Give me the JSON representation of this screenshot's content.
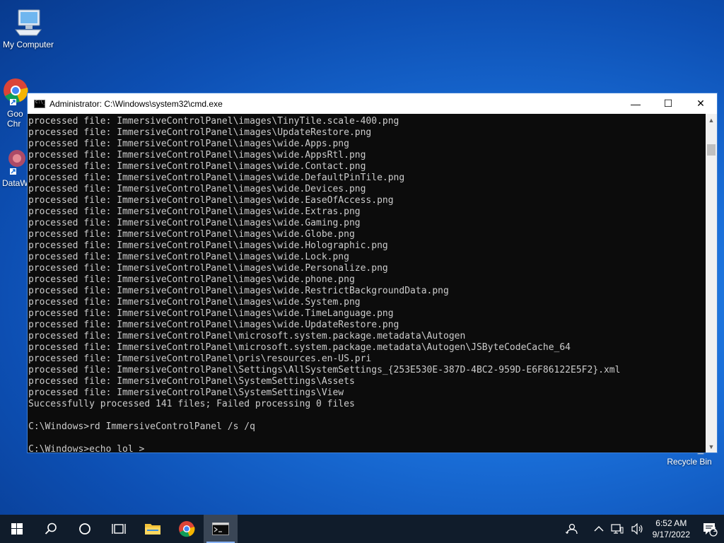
{
  "desktop": {
    "icons": [
      {
        "label": "My Computer"
      },
      {
        "label": "Goo Chr"
      },
      {
        "label": "DataW"
      },
      {
        "label": "Recycle Bin"
      }
    ]
  },
  "window": {
    "title": "Administrator: C:\\Windows\\system32\\cmd.exe",
    "lines": [
      "processed file: ImmersiveControlPanel\\images\\TinyTile.scale-400.png",
      "processed file: ImmersiveControlPanel\\images\\UpdateRestore.png",
      "processed file: ImmersiveControlPanel\\images\\wide.Apps.png",
      "processed file: ImmersiveControlPanel\\images\\wide.AppsRtl.png",
      "processed file: ImmersiveControlPanel\\images\\wide.Contact.png",
      "processed file: ImmersiveControlPanel\\images\\wide.DefaultPinTile.png",
      "processed file: ImmersiveControlPanel\\images\\wide.Devices.png",
      "processed file: ImmersiveControlPanel\\images\\wide.EaseOfAccess.png",
      "processed file: ImmersiveControlPanel\\images\\wide.Extras.png",
      "processed file: ImmersiveControlPanel\\images\\wide.Gaming.png",
      "processed file: ImmersiveControlPanel\\images\\wide.Globe.png",
      "processed file: ImmersiveControlPanel\\images\\wide.Holographic.png",
      "processed file: ImmersiveControlPanel\\images\\wide.Lock.png",
      "processed file: ImmersiveControlPanel\\images\\wide.Personalize.png",
      "processed file: ImmersiveControlPanel\\images\\wide.phone.png",
      "processed file: ImmersiveControlPanel\\images\\wide.RestrictBackgroundData.png",
      "processed file: ImmersiveControlPanel\\images\\wide.System.png",
      "processed file: ImmersiveControlPanel\\images\\wide.TimeLanguage.png",
      "processed file: ImmersiveControlPanel\\images\\wide.UpdateRestore.png",
      "processed file: ImmersiveControlPanel\\microsoft.system.package.metadata\\Autogen",
      "processed file: ImmersiveControlPanel\\microsoft.system.package.metadata\\Autogen\\JSByteCodeCache_64",
      "processed file: ImmersiveControlPanel\\pris\\resources.en-US.pri",
      "processed file: ImmersiveControlPanel\\Settings\\AllSystemSettings_{253E530E-387D-4BC2-959D-E6F86122E5F2}.xml",
      "processed file: ImmersiveControlPanel\\SystemSettings\\Assets",
      "processed file: ImmersiveControlPanel\\SystemSettings\\View",
      "Successfully processed 141 files; Failed processing 0 files",
      "",
      "C:\\Windows>rd ImmersiveControlPanel /s /q",
      "",
      "C:\\Windows>echo lol >"
    ],
    "controls": {
      "minimize": "—",
      "maximize": "☐",
      "close": "✕"
    }
  },
  "taskbar": {
    "clock_time": "6:52 AM",
    "clock_date": "9/17/2022",
    "notification_count": "1"
  },
  "colors": {
    "console_bg": "#0c0c0c",
    "console_text": "#cccccc",
    "taskbar_bg": "#101c2b"
  }
}
